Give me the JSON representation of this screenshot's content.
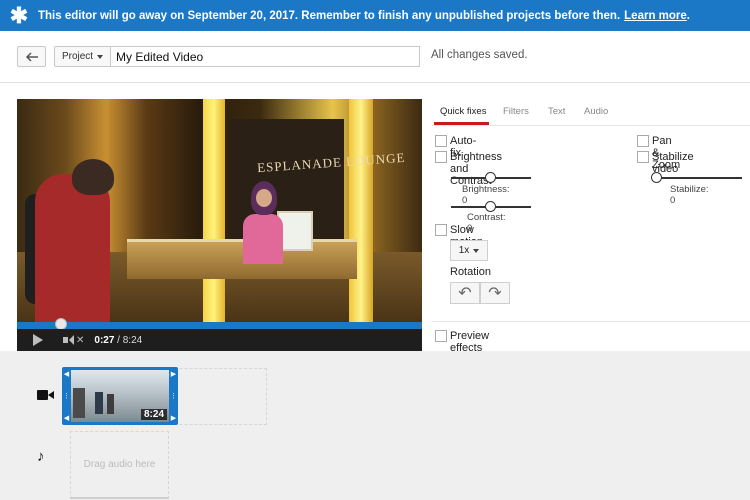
{
  "banner": {
    "message": "This editor will go away on September 20, 2017. Remember to finish any unpublished projects before then.",
    "link": "Learn more",
    "period": ".",
    "color": "#1b78c7"
  },
  "toolbar": {
    "back_icon": "back-arrow-icon",
    "project_label": "Project",
    "title_value": "My Edited Video",
    "save_status": "All changes saved."
  },
  "video": {
    "sign_text": "ESPLANADE LOUNGE",
    "current_time": "0:27",
    "separator": " / ",
    "duration": "8:24",
    "progress_fraction": 0.0536,
    "accent_color": "#1b78c7"
  },
  "tabs": [
    {
      "label": "Quick fixes",
      "active": true
    },
    {
      "label": "Filters",
      "active": false
    },
    {
      "label": "Text",
      "active": false
    },
    {
      "label": "Audio",
      "active": false
    }
  ],
  "quick_fixes": {
    "auto_fix": "Auto-fix",
    "brightness_contrast": "Brightness and Contrast",
    "brightness_label": "Brightness: 0",
    "contrast_label": "Contrast: 0",
    "pan_zoom": "Pan & Zoom",
    "stabilize_video": "Stabilize video",
    "stabilize_label": "Stabilize: 0",
    "slow_motion": "Slow motion",
    "speed_value": "1x",
    "rotation": "Rotation",
    "rotate_left_icon": "rotate-left-icon",
    "rotate_right_icon": "rotate-right-icon",
    "preview_side_by_side": "Preview effects side-by-side with original video"
  },
  "timeline": {
    "video_track_icon": "video-camera-icon",
    "audio_track_icon": "music-note-icon",
    "clip_duration": "8:24",
    "audio_placeholder": "Drag audio here"
  }
}
